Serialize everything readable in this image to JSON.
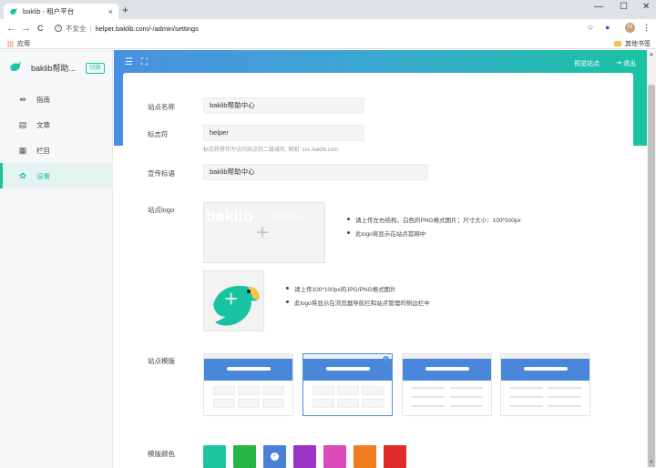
{
  "browser": {
    "tab_title": "baklib - 租户平台",
    "new_tab": "+",
    "tab_close": "×",
    "window_min": "—",
    "window_max": "☐",
    "window_close": "✕",
    "back": "←",
    "forward": "→",
    "reload": "C",
    "insecure_label": "不安全",
    "url": "helper.baklib.com/-/admin/settings",
    "bookmark_apps": "应用",
    "bookmark_other": "其他书签",
    "avatar_initial": "M"
  },
  "sidebar": {
    "site_name": "baklib帮助...",
    "switch_label": "切换",
    "items": [
      {
        "label": "指南",
        "icon": "signpost-icon"
      },
      {
        "label": "文章",
        "icon": "document-icon"
      },
      {
        "label": "栏目",
        "icon": "grid-icon"
      },
      {
        "label": "设置",
        "icon": "gear-icon"
      }
    ]
  },
  "header": {
    "preview_label": "预览站点",
    "logout_label": "退出"
  },
  "form": {
    "site_name_label": "站点名称",
    "site_name_value": "baklib帮助中心",
    "identifier_label": "标志符",
    "identifier_value": "helper",
    "identifier_hint": "标志符将作为访问站点的二级域名, 例如: xxx.baklib.com",
    "slogan_label": "宣传标语",
    "slogan_value": "baklib帮助中心",
    "logo_label": "站点logo",
    "logo_watermark_main": "baklib",
    "logo_watermark_sub": "帮助中心",
    "logo_tips": [
      "请上传左右结构，白色的PNG格式图片；尺寸大小：100*500px",
      "此logo将显示在站点首网中"
    ],
    "favicon_tips": [
      "请上传100*100px的JPG/PNG格式图片",
      "此logo将显示在浏览器导航栏和站点管理的侧边栏中"
    ],
    "template_label": "站点模版",
    "color_label": "模版颜色",
    "colors": [
      "#1ec3a0",
      "#27b544",
      "#4a80d8",
      "#9a34c9",
      "#d94bb8",
      "#f07d1e",
      "#e02b2b"
    ],
    "selected_color_index": 2,
    "selected_template_index": 1
  }
}
